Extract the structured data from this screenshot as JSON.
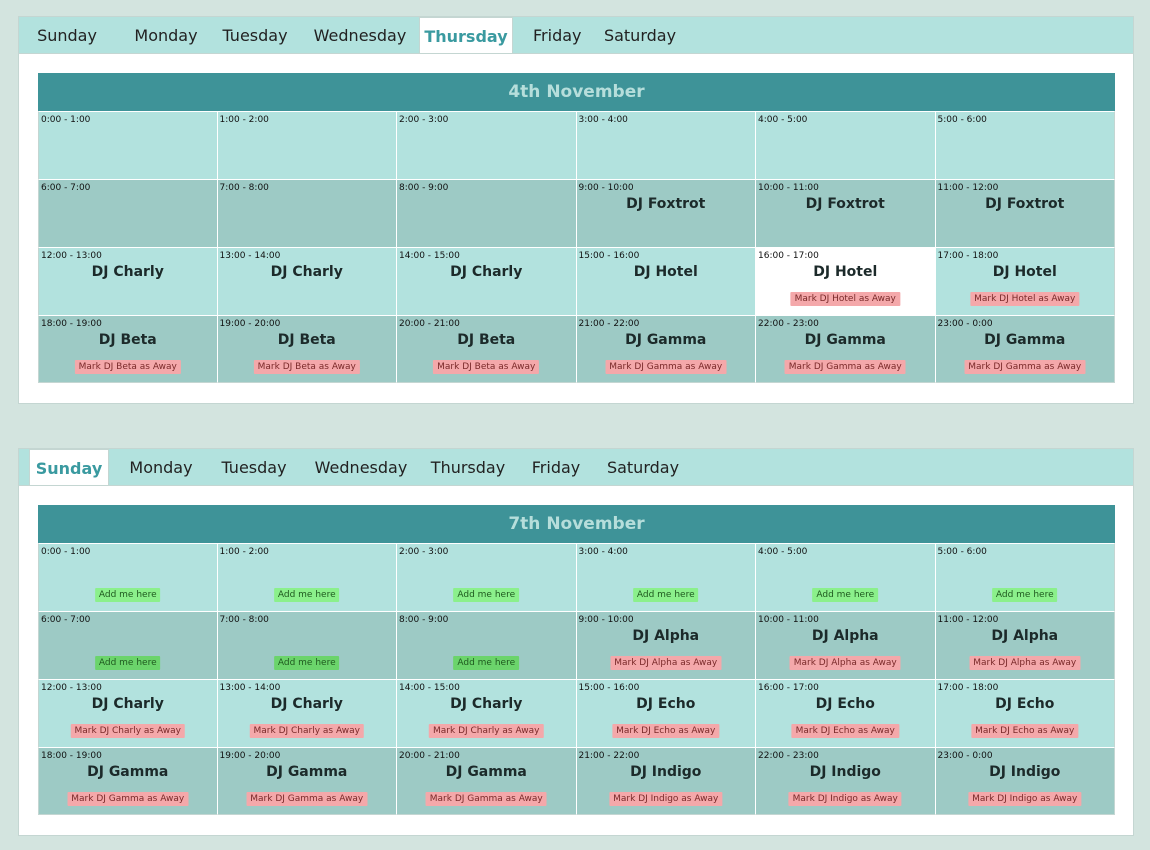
{
  "tabs": [
    "Sunday",
    "Monday",
    "Tuesday",
    "Wednesday",
    "Thursday",
    "Friday",
    "Saturday"
  ],
  "schedules": [
    {
      "active_tab": 4,
      "date": "4th November",
      "slots": [
        {
          "time": "0:00 - 1:00",
          "dj": "",
          "button": ""
        },
        {
          "time": "1:00 - 2:00",
          "dj": "",
          "button": ""
        },
        {
          "time": "2:00 - 3:00",
          "dj": "",
          "button": ""
        },
        {
          "time": "3:00 - 4:00",
          "dj": "",
          "button": ""
        },
        {
          "time": "4:00 - 5:00",
          "dj": "",
          "button": ""
        },
        {
          "time": "5:00 - 6:00",
          "dj": "",
          "button": ""
        },
        {
          "time": "6:00 - 7:00",
          "dj": "",
          "button": ""
        },
        {
          "time": "7:00 - 8:00",
          "dj": "",
          "button": ""
        },
        {
          "time": "8:00 - 9:00",
          "dj": "",
          "button": ""
        },
        {
          "time": "9:00 - 10:00",
          "dj": "DJ Foxtrot",
          "button": ""
        },
        {
          "time": "10:00 - 11:00",
          "dj": "DJ Foxtrot",
          "button": ""
        },
        {
          "time": "11:00 - 12:00",
          "dj": "DJ Foxtrot",
          "button": ""
        },
        {
          "time": "12:00 - 13:00",
          "dj": "DJ Charly",
          "button": ""
        },
        {
          "time": "13:00 - 14:00",
          "dj": "DJ Charly",
          "button": ""
        },
        {
          "time": "14:00 - 15:00",
          "dj": "DJ Charly",
          "button": ""
        },
        {
          "time": "15:00 - 16:00",
          "dj": "DJ Hotel",
          "button": ""
        },
        {
          "time": "16:00 - 17:00",
          "dj": "DJ Hotel",
          "button": "Mark DJ Hotel as Away",
          "kind": "away",
          "highlight": true
        },
        {
          "time": "17:00 - 18:00",
          "dj": "DJ Hotel",
          "button": "Mark DJ Hotel as Away",
          "kind": "away"
        },
        {
          "time": "18:00 - 19:00",
          "dj": "DJ Beta",
          "button": "Mark DJ Beta as Away",
          "kind": "away"
        },
        {
          "time": "19:00 - 20:00",
          "dj": "DJ Beta",
          "button": "Mark DJ Beta as Away",
          "kind": "away"
        },
        {
          "time": "20:00 - 21:00",
          "dj": "DJ Beta",
          "button": "Mark DJ Beta as Away",
          "kind": "away"
        },
        {
          "time": "21:00 - 22:00",
          "dj": "DJ Gamma",
          "button": "Mark DJ Gamma as Away",
          "kind": "away"
        },
        {
          "time": "22:00 - 23:00",
          "dj": "DJ Gamma",
          "button": "Mark DJ Gamma as Away",
          "kind": "away"
        },
        {
          "time": "23:00 - 0:00",
          "dj": "DJ Gamma",
          "button": "Mark DJ Gamma as Away",
          "kind": "away"
        }
      ]
    },
    {
      "active_tab": 0,
      "date": "7th November",
      "slots": [
        {
          "time": "0:00 - 1:00",
          "dj": "",
          "button": "Add me here",
          "kind": "add"
        },
        {
          "time": "1:00 - 2:00",
          "dj": "",
          "button": "Add me here",
          "kind": "add"
        },
        {
          "time": "2:00 - 3:00",
          "dj": "",
          "button": "Add me here",
          "kind": "add"
        },
        {
          "time": "3:00 - 4:00",
          "dj": "",
          "button": "Add me here",
          "kind": "add"
        },
        {
          "time": "4:00 - 5:00",
          "dj": "",
          "button": "Add me here",
          "kind": "add"
        },
        {
          "time": "5:00 - 6:00",
          "dj": "",
          "button": "Add me here",
          "kind": "add"
        },
        {
          "time": "6:00 - 7:00",
          "dj": "",
          "button": "Add me here",
          "kind": "add"
        },
        {
          "time": "7:00 - 8:00",
          "dj": "",
          "button": "Add me here",
          "kind": "add"
        },
        {
          "time": "8:00 - 9:00",
          "dj": "",
          "button": "Add me here",
          "kind": "add"
        },
        {
          "time": "9:00 - 10:00",
          "dj": "DJ Alpha",
          "button": "Mark DJ Alpha as Away",
          "kind": "away"
        },
        {
          "time": "10:00 - 11:00",
          "dj": "DJ Alpha",
          "button": "Mark DJ Alpha as Away",
          "kind": "away"
        },
        {
          "time": "11:00 - 12:00",
          "dj": "DJ Alpha",
          "button": "Mark DJ Alpha as Away",
          "kind": "away"
        },
        {
          "time": "12:00 - 13:00",
          "dj": "DJ Charly",
          "button": "Mark DJ Charly as Away",
          "kind": "away"
        },
        {
          "time": "13:00 - 14:00",
          "dj": "DJ Charly",
          "button": "Mark DJ Charly as Away",
          "kind": "away"
        },
        {
          "time": "14:00 - 15:00",
          "dj": "DJ Charly",
          "button": "Mark DJ Charly as Away",
          "kind": "away"
        },
        {
          "time": "15:00 - 16:00",
          "dj": "DJ Echo",
          "button": "Mark DJ Echo as Away",
          "kind": "away"
        },
        {
          "time": "16:00 - 17:00",
          "dj": "DJ Echo",
          "button": "Mark DJ Echo as Away",
          "kind": "away"
        },
        {
          "time": "17:00 - 18:00",
          "dj": "DJ Echo",
          "button": "Mark DJ Echo as Away",
          "kind": "away"
        },
        {
          "time": "18:00 - 19:00",
          "dj": "DJ Gamma",
          "button": "Mark DJ Gamma as Away",
          "kind": "away"
        },
        {
          "time": "19:00 - 20:00",
          "dj": "DJ Gamma",
          "button": "Mark DJ Gamma as Away",
          "kind": "away"
        },
        {
          "time": "20:00 - 21:00",
          "dj": "DJ Gamma",
          "button": "Mark DJ Gamma as Away",
          "kind": "away"
        },
        {
          "time": "21:00 - 22:00",
          "dj": "DJ Indigo",
          "button": "Mark DJ Indigo as Away",
          "kind": "away"
        },
        {
          "time": "22:00 - 23:00",
          "dj": "DJ Indigo",
          "button": "Mark DJ Indigo as Away",
          "kind": "away"
        },
        {
          "time": "23:00 - 0:00",
          "dj": "DJ Indigo",
          "button": "Mark DJ Indigo as Away",
          "kind": "away"
        }
      ]
    }
  ]
}
